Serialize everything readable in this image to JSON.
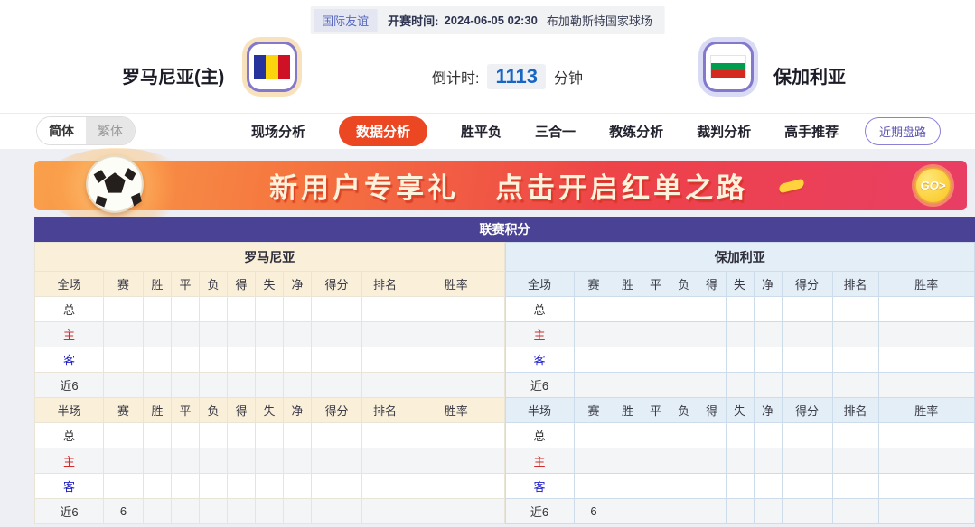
{
  "header": {
    "league_badge": "国际友谊",
    "kickoff_label": "开赛时间:",
    "kickoff_time": "2024-06-05 02:30",
    "venue": "布加勒斯特国家球场",
    "home_team": "罗马尼亚(主)",
    "away_team": "保加利亚",
    "countdown_label": "倒计时:",
    "countdown_value": "1113",
    "countdown_unit": "分钟"
  },
  "nav": {
    "lang_simplified": "简体",
    "lang_traditional": "繁体",
    "tabs": [
      {
        "label": "现场分析",
        "active": false
      },
      {
        "label": "数据分析",
        "active": true
      },
      {
        "label": "胜平负",
        "active": false
      },
      {
        "label": "三合一",
        "active": false
      },
      {
        "label": "教练分析",
        "active": false
      },
      {
        "label": "裁判分析",
        "active": false
      },
      {
        "label": "高手推荐",
        "active": false
      }
    ],
    "recent_trend_button": "近期盘路"
  },
  "banner": {
    "text1": "新用户专享礼",
    "text2": "点击开启红单之路",
    "go_label": "GO>"
  },
  "table": {
    "title": "联赛积分",
    "columns_full": [
      "全场",
      "赛",
      "胜",
      "平",
      "负",
      "得",
      "失",
      "净",
      "得分",
      "排名",
      "胜率"
    ],
    "columns_half": [
      "半场",
      "赛",
      "胜",
      "平",
      "负",
      "得",
      "失",
      "净",
      "得分",
      "排名",
      "胜率"
    ],
    "row_label_colors": {
      "总": "#333333",
      "主": "#d42a2a",
      "客": "#2020c8",
      "近6": "#333333"
    },
    "home": {
      "name": "罗马尼亚",
      "full": [
        {
          "label": "总",
          "cells": [
            "",
            "",
            "",
            "",
            "",
            "",
            "",
            "",
            "",
            ""
          ]
        },
        {
          "label": "主",
          "cells": [
            "",
            "",
            "",
            "",
            "",
            "",
            "",
            "",
            "",
            ""
          ]
        },
        {
          "label": "客",
          "cells": [
            "",
            "",
            "",
            "",
            "",
            "",
            "",
            "",
            "",
            ""
          ]
        },
        {
          "label": "近6",
          "cells": [
            "",
            "",
            "",
            "",
            "",
            "",
            "",
            "",
            "",
            ""
          ]
        }
      ],
      "half": [
        {
          "label": "总",
          "cells": [
            "",
            "",
            "",
            "",
            "",
            "",
            "",
            "",
            "",
            ""
          ]
        },
        {
          "label": "主",
          "cells": [
            "",
            "",
            "",
            "",
            "",
            "",
            "",
            "",
            "",
            ""
          ]
        },
        {
          "label": "客",
          "cells": [
            "",
            "",
            "",
            "",
            "",
            "",
            "",
            "",
            "",
            ""
          ]
        },
        {
          "label": "近6",
          "cells": [
            "6",
            "",
            "",
            "",
            "",
            "",
            "",
            "",
            "",
            ""
          ]
        }
      ]
    },
    "away": {
      "name": "保加利亚",
      "full": [
        {
          "label": "总",
          "cells": [
            "",
            "",
            "",
            "",
            "",
            "",
            "",
            "",
            "",
            ""
          ]
        },
        {
          "label": "主",
          "cells": [
            "",
            "",
            "",
            "",
            "",
            "",
            "",
            "",
            "",
            ""
          ]
        },
        {
          "label": "客",
          "cells": [
            "",
            "",
            "",
            "",
            "",
            "",
            "",
            "",
            "",
            ""
          ]
        },
        {
          "label": "近6",
          "cells": [
            "",
            "",
            "",
            "",
            "",
            "",
            "",
            "",
            "",
            ""
          ]
        }
      ],
      "half": [
        {
          "label": "总",
          "cells": [
            "",
            "",
            "",
            "",
            "",
            "",
            "",
            "",
            "",
            ""
          ]
        },
        {
          "label": "主",
          "cells": [
            "",
            "",
            "",
            "",
            "",
            "",
            "",
            "",
            "",
            ""
          ]
        },
        {
          "label": "客",
          "cells": [
            "",
            "",
            "",
            "",
            "",
            "",
            "",
            "",
            "",
            ""
          ]
        },
        {
          "label": "近6",
          "cells": [
            "6",
            "",
            "",
            "",
            "",
            "",
            "",
            "",
            "",
            ""
          ]
        }
      ]
    }
  },
  "colors": {
    "table_header_purple": "#4a4294",
    "active_tab_orange": "#ea4722",
    "countdown_blue": "#1766c5",
    "home_half_cream": "#faf0da",
    "away_half_blue": "#e3eef7",
    "home_row_red": "#d42a2a",
    "away_row_blue": "#2020c8",
    "banner_gradient_start": "#f9a04b",
    "banner_gradient_end": "#e93e64",
    "go_yellow": "#fbcf38"
  }
}
